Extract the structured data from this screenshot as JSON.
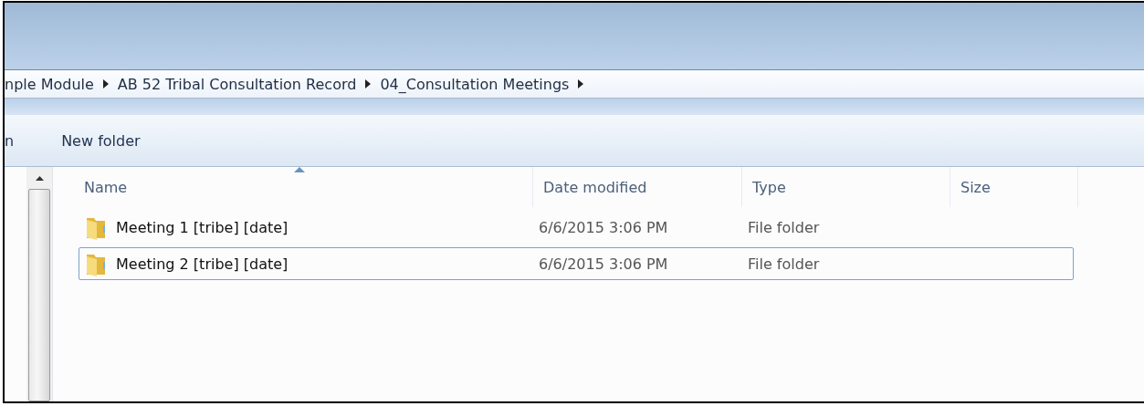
{
  "breadcrumb": [
    "nple Module",
    "AB 52 Tribal Consultation Record",
    "04_Consultation Meetings"
  ],
  "toolbar": [
    "n",
    "New folder"
  ],
  "table": {
    "columns": [
      {
        "label": "Name",
        "sorted": true
      },
      {
        "label": "Date modified",
        "sorted": false
      },
      {
        "label": "Type",
        "sorted": false
      },
      {
        "label": "Size",
        "sorted": false
      }
    ],
    "rows": [
      {
        "name": "Meeting 1 [tribe] [date]",
        "date_modified": "6/6/2015 3:06 PM",
        "type": "File folder",
        "selected": false
      },
      {
        "name": "Meeting 2 [tribe] [date]",
        "date_modified": "6/6/2015 3:06 PM",
        "type": "File folder",
        "selected": true
      }
    ]
  }
}
